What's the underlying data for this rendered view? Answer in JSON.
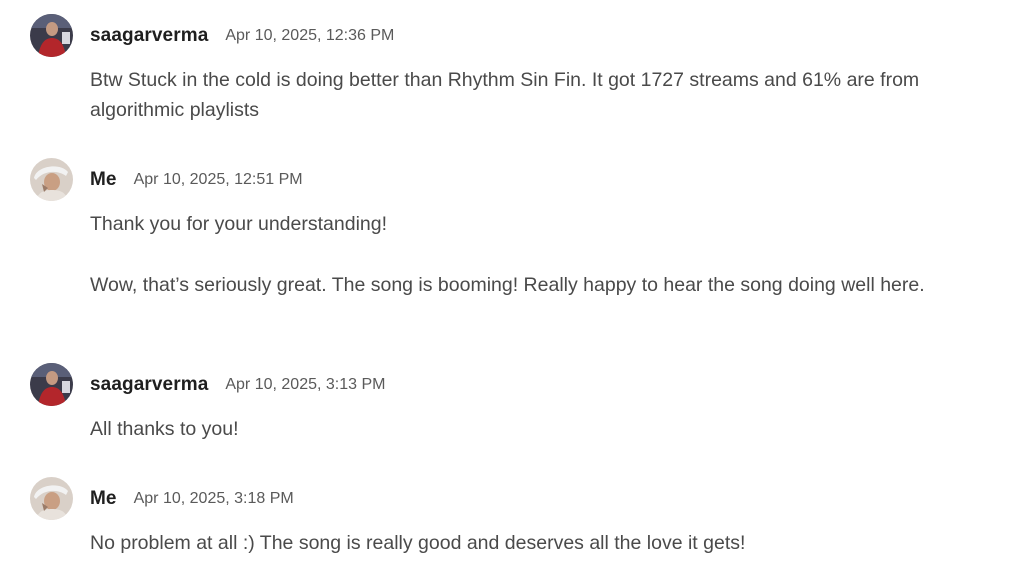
{
  "messages": [
    {
      "author": "saagarverma",
      "timestamp": "Apr 10, 2025, 12:36 PM",
      "paragraphs": [
        "Btw Stuck in the cold is doing better than Rhythm Sin Fin. It got 1727 streams and 61% are from algorithmic playlists"
      ]
    },
    {
      "author": "Me",
      "timestamp": "Apr 10, 2025, 12:51 PM",
      "paragraphs": [
        "Thank you for your understanding!",
        "Wow, that’s seriously great. The song is booming! Really happy to hear the song doing well here."
      ]
    },
    {
      "author": "saagarverma",
      "timestamp": "Apr 10, 2025, 3:13 PM",
      "paragraphs": [
        "All thanks to you!"
      ]
    },
    {
      "author": "Me",
      "timestamp": "Apr 10, 2025, 3:18 PM",
      "paragraphs": [
        "No problem at all :) The song is really good and deserves all the love it gets!"
      ]
    }
  ],
  "colors": {
    "author": "#1f1f1f",
    "timestamp": "#5a5a5a",
    "body_text": "#4a4a4a",
    "background": "#ffffff"
  }
}
